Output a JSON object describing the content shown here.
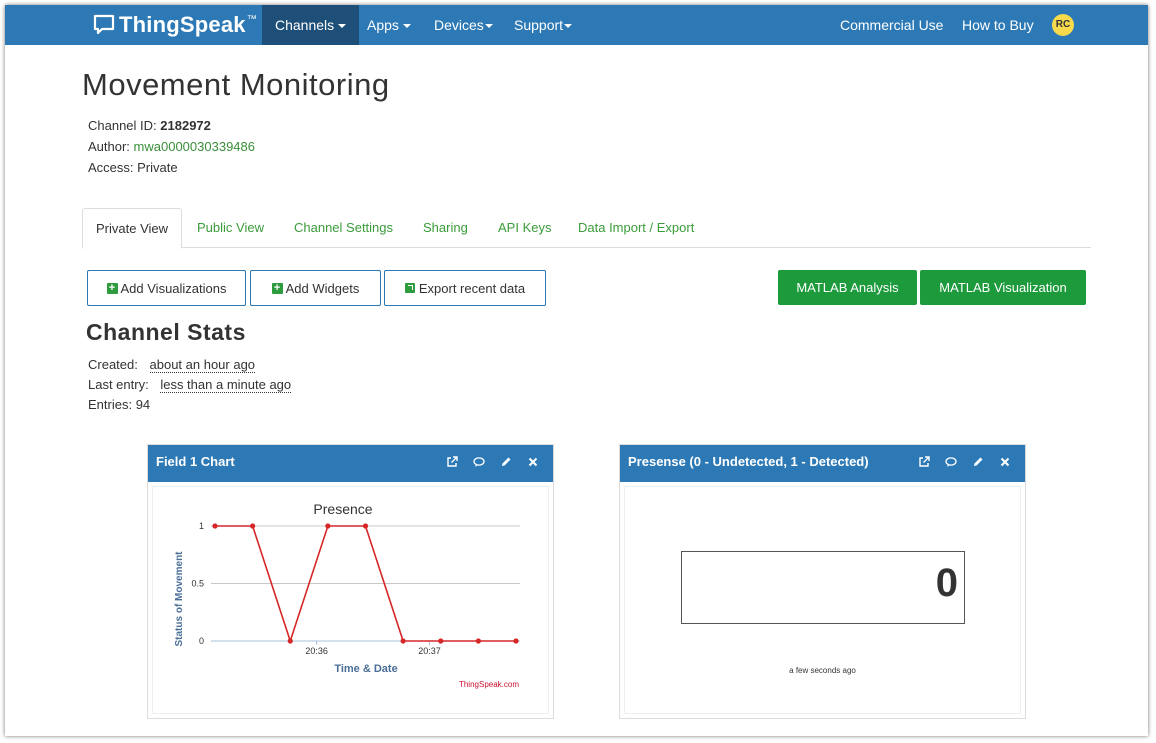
{
  "nav": {
    "logo": "ThingSpeak",
    "logo_tm": "™",
    "items": [
      "Channels",
      "Apps",
      "Devices",
      "Support"
    ],
    "right": [
      "Commercial Use",
      "How to Buy"
    ],
    "avatar": "RC"
  },
  "channel": {
    "title": "Movement Monitoring",
    "id_label": "Channel ID:",
    "id": "2182972",
    "author_label": "Author:",
    "author": "mwa0000030339486",
    "access_label": "Access:",
    "access": "Private"
  },
  "tabs": [
    "Private View",
    "Public View",
    "Channel Settings",
    "Sharing",
    "API Keys",
    "Data Import / Export"
  ],
  "actions": {
    "add_visualizations": "Add Visualizations",
    "add_widgets": "Add Widgets",
    "export_recent": "Export recent data",
    "matlab_analysis": "MATLAB Analysis",
    "matlab_visualization": "MATLAB Visualization"
  },
  "stats": {
    "title": "Channel Stats",
    "created_label": "Created:",
    "created": "about an hour ago",
    "last_entry_label": "Last entry:",
    "last_entry": "less than a minute ago",
    "entries_label": "Entries:",
    "entries": "94"
  },
  "widgets": {
    "chart_title": "Field 1 Chart",
    "display_title": "Presense (0 - Undetected, 1 - Detected)",
    "display_value": "0",
    "display_time": "a few seconds ago",
    "credit": "ThingSpeak.com"
  },
  "colors": {
    "nav": "#2d79b5",
    "nav_active": "#1d4f78",
    "link_green": "#3a9c3a",
    "button_green": "#1d9a3c",
    "series": "#d62728"
  },
  "chart_data": {
    "type": "line",
    "title": "Presence",
    "xlabel": "Time & Date",
    "ylabel": "Status of Movement",
    "x_ticks": [
      "20:36",
      "20:37"
    ],
    "y_ticks": [
      "0",
      "0.5",
      "1"
    ],
    "ylim": [
      0,
      1
    ],
    "grid": true,
    "values": [
      1,
      1,
      0,
      1,
      1,
      0,
      0,
      0,
      0
    ]
  }
}
